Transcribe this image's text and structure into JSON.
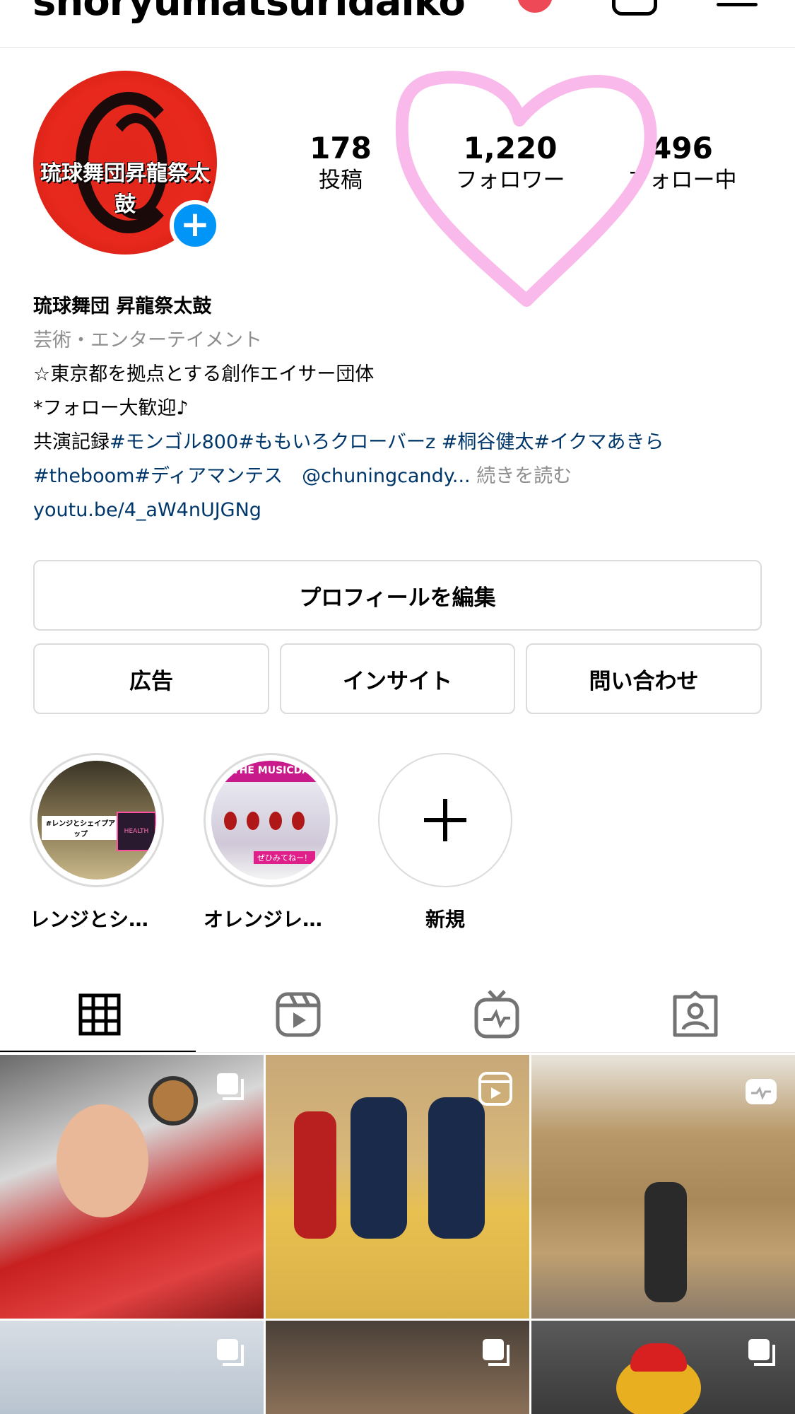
{
  "header": {
    "username": "shoryumatsuridaiko"
  },
  "profile": {
    "avatar_text": "琉球舞団昇龍祭太鼓"
  },
  "stats": [
    {
      "value": "178",
      "label": "投稿"
    },
    {
      "value": "1,220",
      "label": "フォロワー"
    },
    {
      "value": "496",
      "label": "フォロー中"
    }
  ],
  "bio": {
    "name": "琉球舞団 昇龍祭太鼓",
    "category": "芸術・エンターテイメント",
    "line1": "☆東京都を拠点とする創作エイサー団体",
    "line2": "*フォロー大歓迎♪",
    "line3_prefix": "共演記録",
    "line3_tags": "#モンゴル800#ももいろクローバーz #桐谷健太#イクマあきら",
    "line4_tags": "#theboom#ディアマンテス　@chuningcandy",
    "line4_ellipsis": "...",
    "more": "続きを読む",
    "link": "youtu.be/4_aW4nUJGNg"
  },
  "buttons": {
    "edit_profile": "プロフィールを編集",
    "ads": "広告",
    "insights": "インサイト",
    "contact": "問い合わせ"
  },
  "highlights": [
    {
      "label": "レンジとシェ…",
      "thumb_text": "#レンジとシェイプアップ",
      "thumb_text2": "HEALTH"
    },
    {
      "label": "オレンジレン…",
      "thumb_text": "THE MUSICDAY",
      "thumb_text2": "ぜひみてねー！"
    },
    {
      "label": "新規",
      "icon": "plus-icon"
    }
  ],
  "tabs": [
    {
      "name": "grid",
      "icon": "grid-icon",
      "active": true
    },
    {
      "name": "reels",
      "icon": "reels-icon",
      "active": false
    },
    {
      "name": "igtv",
      "icon": "igtv-icon",
      "active": false
    },
    {
      "name": "tagged",
      "icon": "tagged-icon",
      "active": false
    }
  ],
  "posts": [
    {
      "type": "carousel"
    },
    {
      "type": "reel"
    },
    {
      "type": "igtv"
    },
    {
      "type": "carousel"
    },
    {
      "type": "carousel"
    },
    {
      "type": "carousel"
    }
  ],
  "colors": {
    "accent_blue": "#0095f6",
    "link_blue": "#00376b",
    "notification_red": "#ed4956",
    "heart_pink": "#f9b9ea"
  }
}
